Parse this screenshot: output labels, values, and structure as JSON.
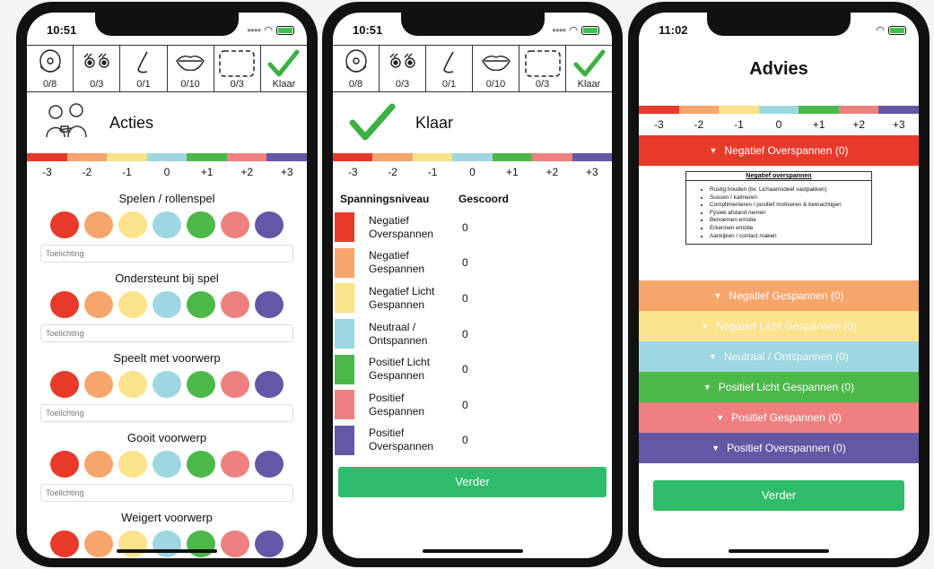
{
  "colors": [
    "#e83a2b",
    "#f6a56b",
    "#fbe38b",
    "#9ed7e1",
    "#4cb84a",
    "#ef8080",
    "#6457a6"
  ],
  "scale": [
    "-3",
    "-2",
    "-1",
    "0",
    "+1",
    "+2",
    "+3"
  ],
  "tabs": [
    {
      "icon": "face-icon",
      "count": "0/8"
    },
    {
      "icon": "eyes-icon",
      "count": "0/3"
    },
    {
      "icon": "nose-icon",
      "count": "0/1"
    },
    {
      "icon": "mouth-icon",
      "count": "0/10"
    },
    {
      "icon": "dashed-box-icon",
      "count": "0/3"
    },
    {
      "icon": "checkmark-icon",
      "count": "Klaar"
    }
  ],
  "screen1": {
    "time": "10:51",
    "title": "Acties",
    "note_placeholder": "Toelichting",
    "questions": [
      "Spelen / rollenspel",
      "Ondersteunt bij spel",
      "Speelt met voorwerp",
      "Gooit voorwerp",
      "Weigert voorwerp"
    ]
  },
  "screen2": {
    "time": "10:51",
    "title": "Klaar",
    "col_level": "Spanningsniveau",
    "col_score": "Gescoord",
    "levels": [
      {
        "name": "Negatief Overspannen",
        "score": "0"
      },
      {
        "name": "Negatief Gespannen",
        "score": "0"
      },
      {
        "name": "Negatief Licht Gespannen",
        "score": "0"
      },
      {
        "name": "Neutraal / Ontspannen",
        "score": "0"
      },
      {
        "name": "Positief Licht Gespannen",
        "score": "0"
      },
      {
        "name": "Positief Gespannen",
        "score": "0"
      },
      {
        "name": "Positief Overspannen",
        "score": "0"
      }
    ],
    "button": "Verder"
  },
  "screen3": {
    "time": "11:02",
    "title": "Advies",
    "sections": [
      "Negatief Overspannen (0)",
      "Negatief Gespannen (0)",
      "Negatief Licht Gespannen (0)",
      "Neutraal / Ontspannen (0)",
      "Positief Licht Gespannen (0)",
      "Positief Gespannen (0)",
      "Positief Overspannen (0)"
    ],
    "detail": {
      "heading": "Negatief overspannen",
      "items": [
        "Rustig houden (bv. Lichaamsdeel vastpakken)",
        "Sussen / kalmeren",
        "Complimenteren / positief motiveren & bekrachtigen",
        "Fysiek afstand nemen",
        "Benoemen emotie",
        "Erkennen emotie",
        "Aankijken / contact maken"
      ]
    },
    "button": "Verder"
  }
}
